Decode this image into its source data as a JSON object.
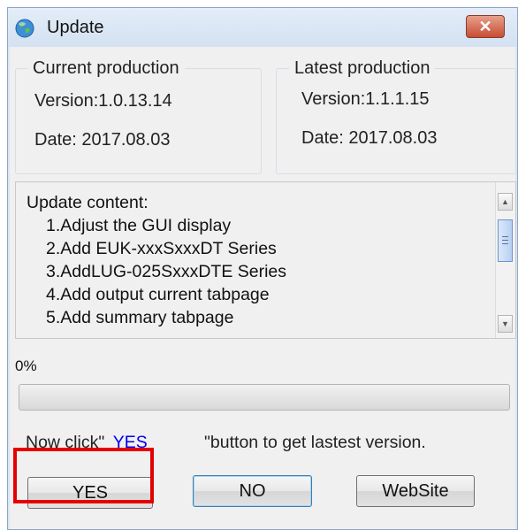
{
  "window": {
    "title": "Update",
    "close_glyph": "✕",
    "icon": "globe-icon"
  },
  "current": {
    "heading": "Current production",
    "version": "Version:1.0.13.14",
    "date": "Date: 2017.08.03"
  },
  "latest": {
    "heading": "Latest production",
    "version": "Version:1.1.1.15",
    "date": "Date: 2017.08.03"
  },
  "update_content": {
    "heading": "Update content:",
    "items": [
      "1.Adjust the GUI display",
      "2.Add EUK-xxxSxxxDT Series",
      "3.AddLUG-025SxxxDTE Series",
      "4.Add output current tabpage",
      "5.Add summary tabpage"
    ]
  },
  "progress": {
    "label": "0%",
    "value": 0
  },
  "hint": {
    "prefix": "Now click\"",
    "link": "YES",
    "suffix": "\"button to get lastest version."
  },
  "buttons": {
    "yes": "YES",
    "no": "NO",
    "website": "WebSite"
  },
  "colors": {
    "highlight": "#e50000",
    "link": "#0000ee",
    "progress_fill": "#06b025"
  }
}
